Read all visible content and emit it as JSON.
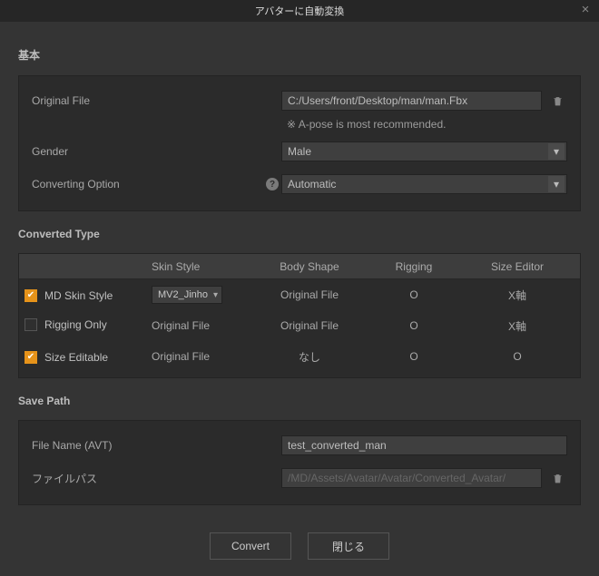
{
  "titlebar": {
    "title": "アバターに自動変換"
  },
  "sections": {
    "basic_title": "基本",
    "converted_type_title": "Converted Type",
    "save_path_title": "Save Path"
  },
  "basic": {
    "original_file_label": "Original File",
    "original_file_value": "C:/Users/front/Desktop/man/man.Fbx",
    "original_file_hint": "※ A-pose is most recommended.",
    "gender_label": "Gender",
    "gender_value": "Male",
    "converting_option_label": "Converting Option",
    "converting_option_value": "Automatic"
  },
  "table": {
    "headers": {
      "skin_style": "Skin Style",
      "body_shape": "Body Shape",
      "rigging": "Rigging",
      "size_editor": "Size Editor"
    },
    "rows": [
      {
        "check": true,
        "label": "MD Skin Style",
        "skin_style_select": "MV2_Jinho",
        "body_shape": "Original File",
        "rigging": "O",
        "size_editor": "X軸"
      },
      {
        "check": false,
        "label": "Rigging Only",
        "skin_style_text": "Original File",
        "body_shape": "Original File",
        "rigging": "O",
        "size_editor": "X軸"
      },
      {
        "check": true,
        "label": "Size Editable",
        "skin_style_text": "Original File",
        "body_shape": "なし",
        "rigging": "O",
        "size_editor": "O"
      }
    ]
  },
  "save": {
    "file_name_label": "File Name (AVT)",
    "file_name_value": "test_converted_man",
    "file_path_label": "ファイルパス",
    "file_path_value": "/MD/Assets/Avatar/Avatar/Converted_Avatar/"
  },
  "buttons": {
    "convert": "Convert",
    "close": "閉じる"
  }
}
